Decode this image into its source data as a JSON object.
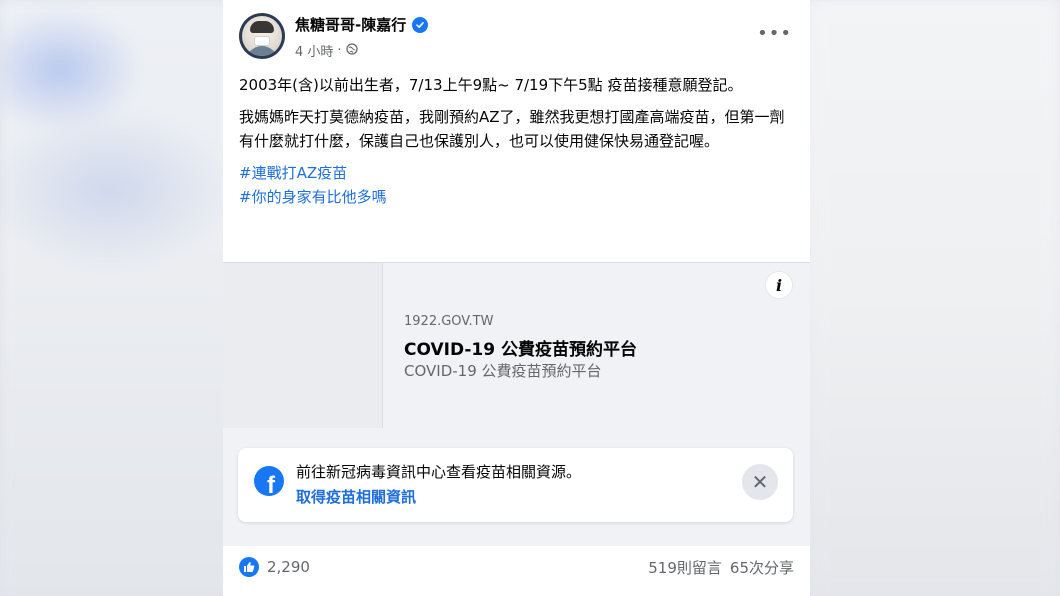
{
  "post": {
    "author": "焦糖哥哥-陳嘉行",
    "time": "4 小時",
    "meta_separator": "·",
    "more_label": "•••",
    "paragraphs": [
      "2003年(含)以前出生者，7/13上午9點~ 7/19下午5點 疫苗接種意願登記。",
      "我媽媽昨天打莫德納疫苗，我剛預約AZ了，雖然我更想打國產高端疫苗，但第一劑有什麼就打什麼，保護自己也保護別人，也可以使用健保快易通登記喔。"
    ],
    "hashtags": [
      "#連戰打AZ疫苗",
      "#你的身家有比他多嗎"
    ]
  },
  "link_preview": {
    "info_label": "i",
    "domain": "1922.GOV.TW",
    "title": "COVID-19 公費疫苗預約平台",
    "description": "COVID-19 公費疫苗預約平台"
  },
  "notice": {
    "logo_letter": "f",
    "text": "前往新冠病毒資訊中心查看疫苗相關資源。",
    "link": "取得疫苗相關資訊",
    "close_label": "✕"
  },
  "footer": {
    "likes": "2,290",
    "comments": "519則留言",
    "shares": "65次分享"
  },
  "colors": {
    "accent": "#1877f2",
    "link": "#216fdb",
    "secondary_text": "#65676b"
  },
  "icons": [
    "verified-badge-icon",
    "globe-icon",
    "more-options-icon",
    "info-icon",
    "facebook-logo-icon",
    "close-icon",
    "like-icon"
  ]
}
